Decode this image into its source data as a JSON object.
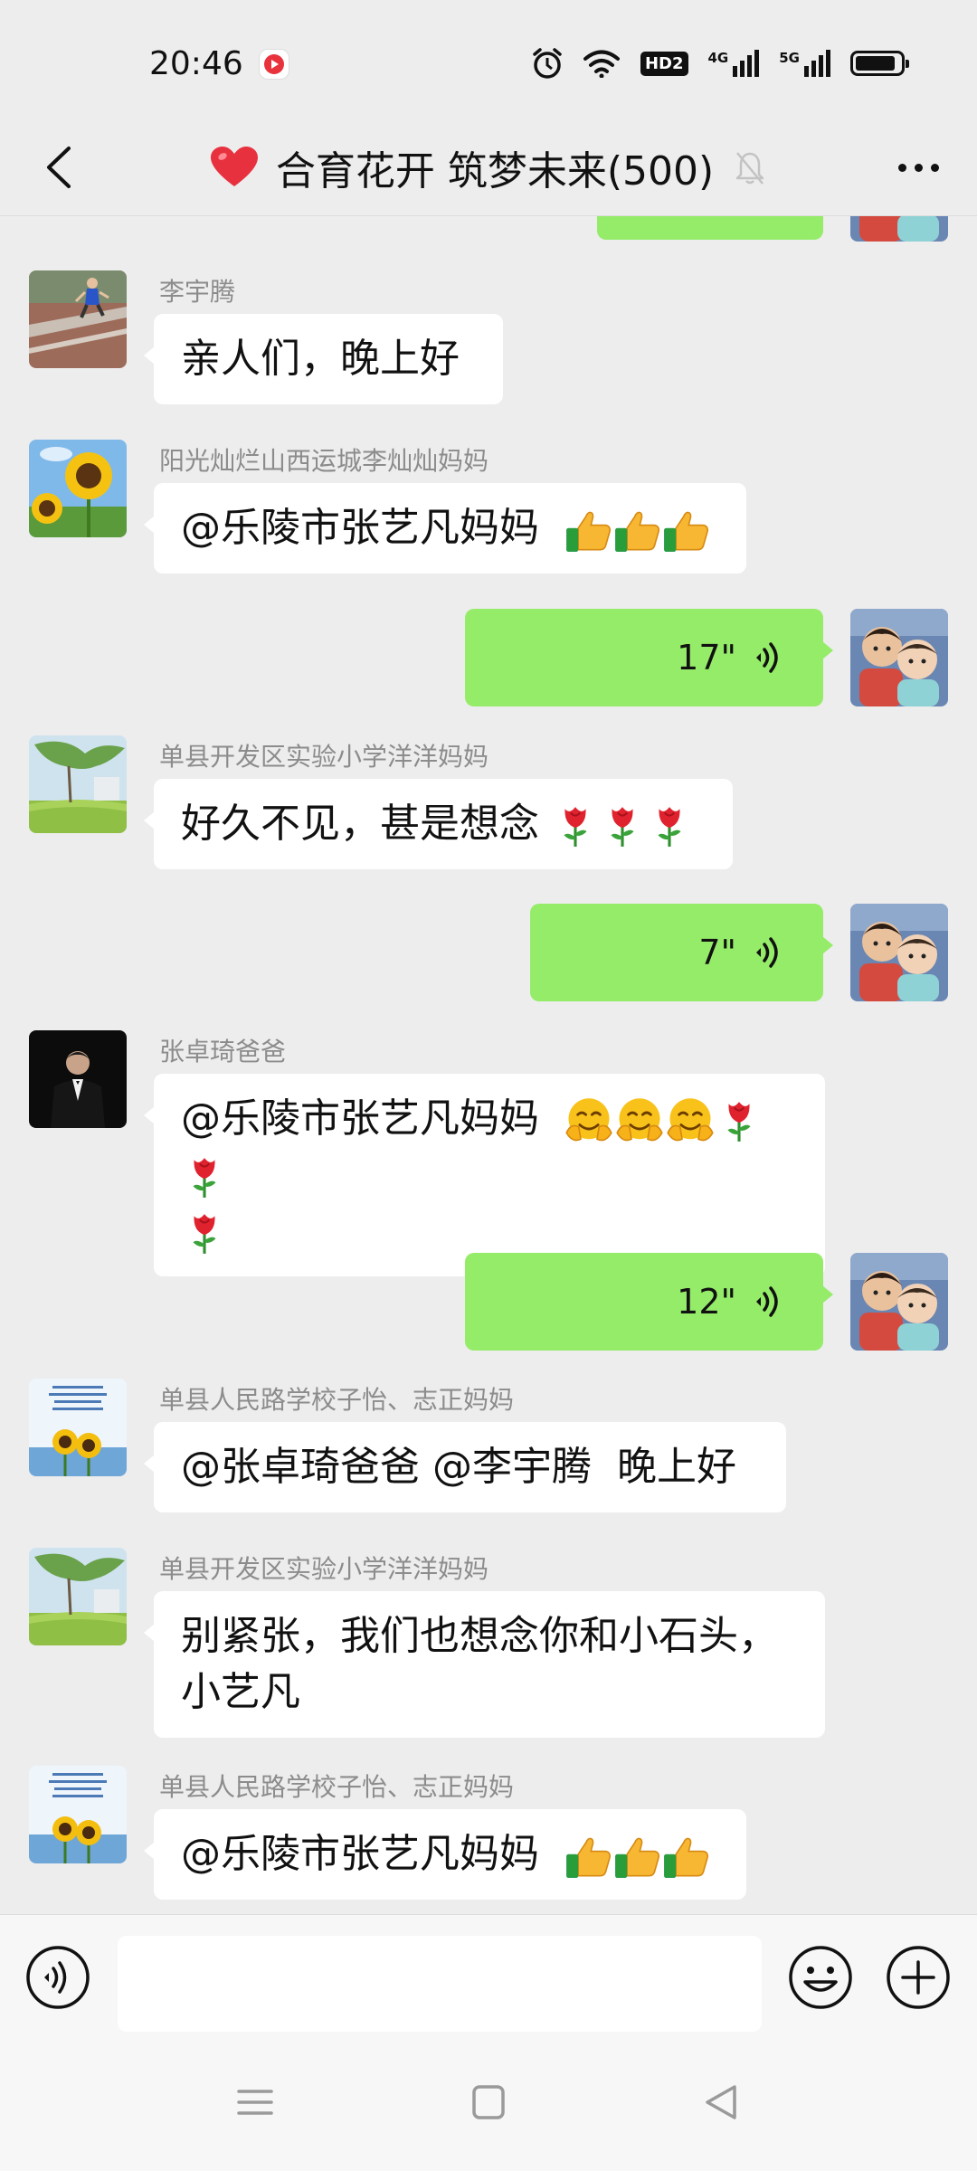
{
  "status_bar": {
    "time": "20:46",
    "hd_label": "HD2",
    "net1": "4G",
    "net2": "5G"
  },
  "header": {
    "title": "合育花开 筑梦未来(500)"
  },
  "messages": [
    {
      "type": "text",
      "side": "left",
      "sender": "李宇腾",
      "text": "亲人们，晚上好"
    },
    {
      "type": "text",
      "side": "left",
      "sender": "阳光灿烂山西运城李灿灿妈妈",
      "text": "@乐陵市张艺凡妈妈"
    },
    {
      "type": "voice",
      "side": "right",
      "duration": "17\""
    },
    {
      "type": "text",
      "side": "left",
      "sender": "单县开发区实验小学洋洋妈妈",
      "text": "好久不见，甚是想念"
    },
    {
      "type": "voice",
      "side": "right",
      "duration": "7\""
    },
    {
      "type": "text",
      "side": "left",
      "sender": "张卓琦爸爸",
      "text": "@乐陵市张艺凡妈妈"
    },
    {
      "type": "voice",
      "side": "right",
      "duration": "12\""
    },
    {
      "type": "text",
      "side": "left",
      "sender": "单县人民路学校子怡、志正妈妈",
      "text": "@张卓琦爸爸 @李宇腾  晚上好"
    },
    {
      "type": "text",
      "side": "left",
      "sender": "单县开发区实验小学洋洋妈妈",
      "text_line1": "别紧张，我们也想念你和小石头，",
      "text_line2": "小艺凡"
    },
    {
      "type": "text",
      "side": "left",
      "sender": "单县人民路学校子怡、志正妈妈",
      "text": "@乐陵市张艺凡妈妈"
    }
  ],
  "icons": {
    "back": "chevron-left-icon",
    "heart": "heart-icon",
    "mute": "bell-off-icon",
    "more": "more-dots-icon",
    "voice_input": "voice-input-icon",
    "emoji": "emoji-icon",
    "plus": "plus-icon",
    "thumbs_up": "thumbs-up-emoji",
    "rose": "rose-emoji",
    "hug": "hug-emoji"
  },
  "colors": {
    "background": "#ededed",
    "outgoing_bubble": "#95ec69",
    "incoming_bubble": "#ffffff",
    "sender_name": "#8c8c8c"
  }
}
